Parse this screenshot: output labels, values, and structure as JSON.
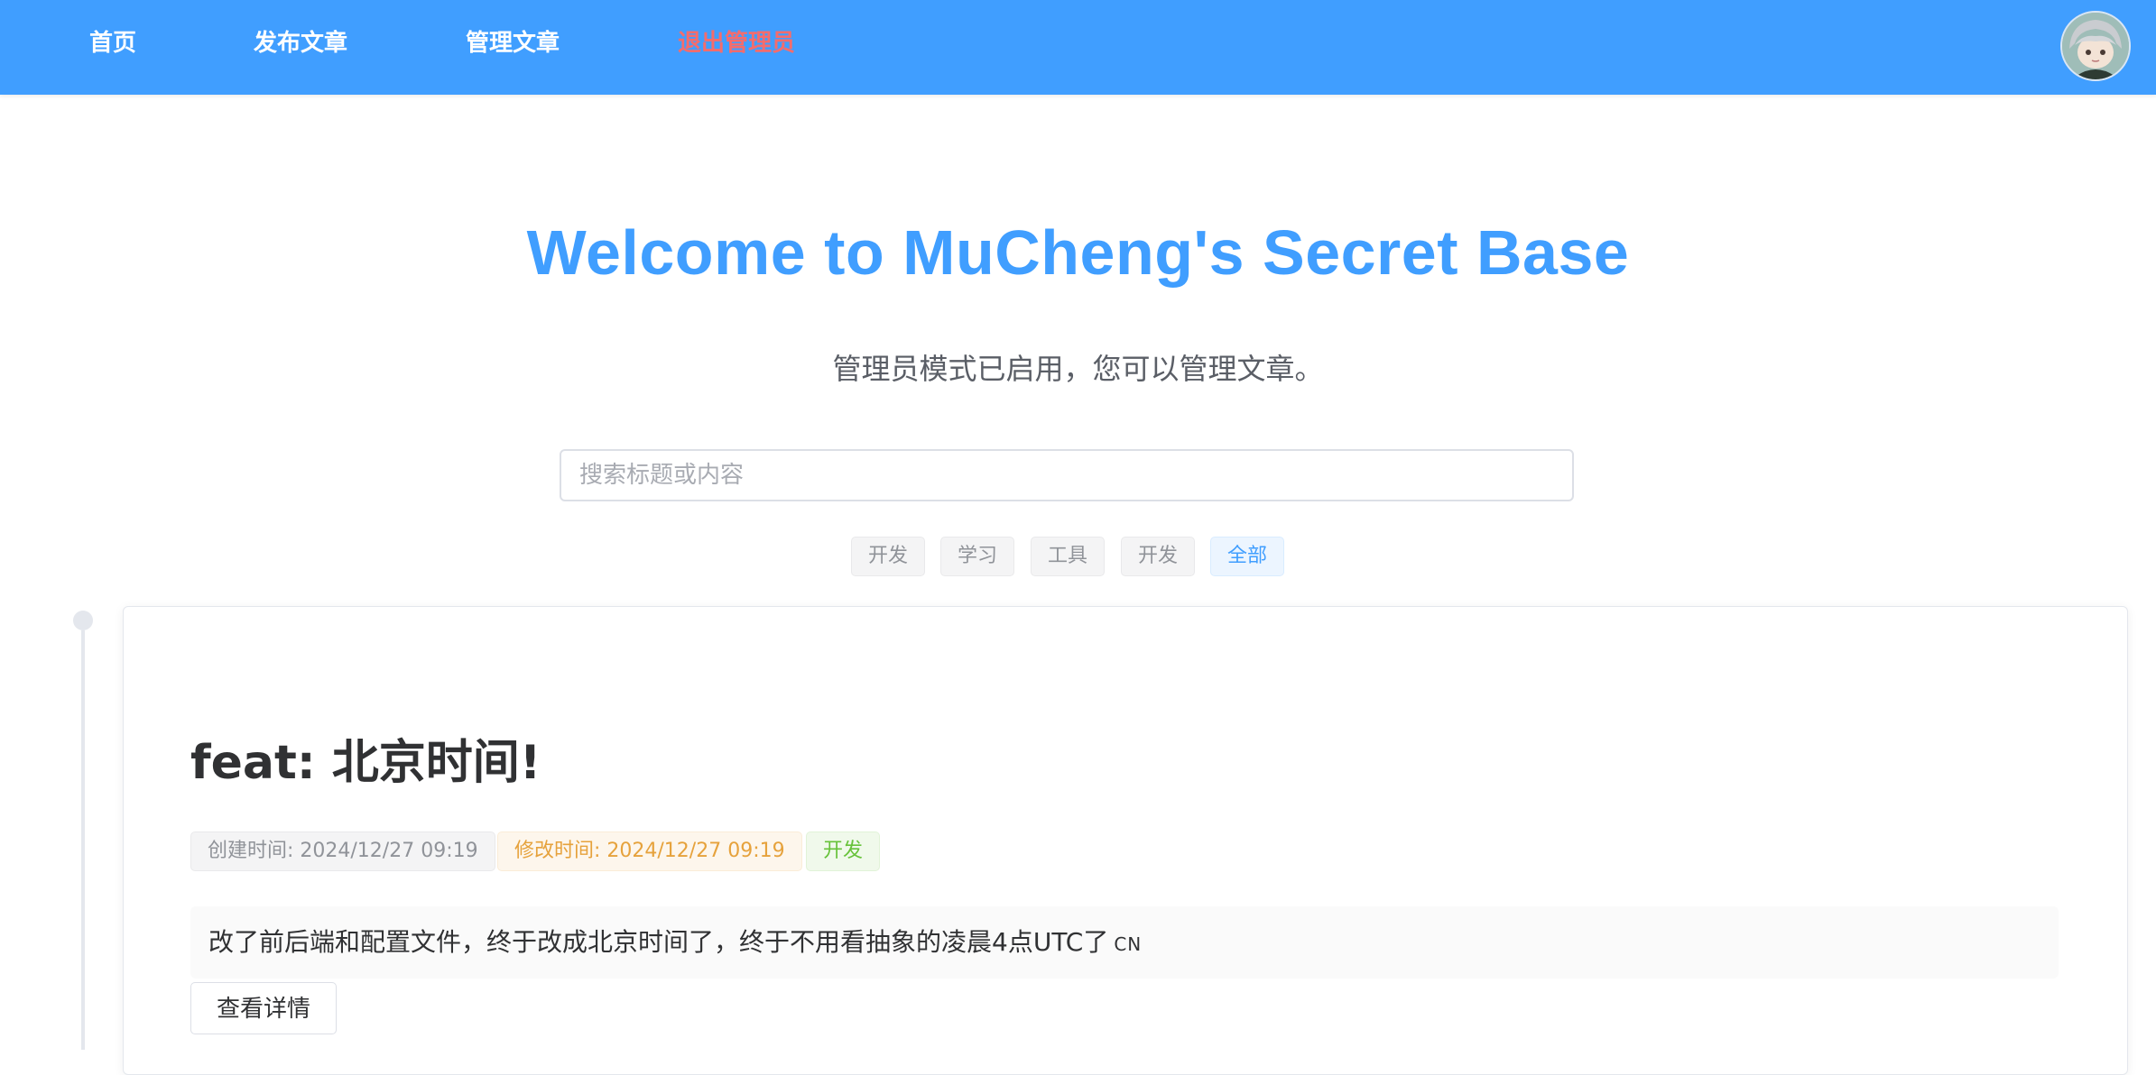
{
  "nav": {
    "home": "首页",
    "publish": "发布文章",
    "manage": "管理文章",
    "logout_admin": "退出管理员"
  },
  "avatar_icon": "user-avatar-icon",
  "hero": {
    "title": "Welcome to MuCheng's Secret Base",
    "subtitle": "管理员模式已启用，您可以管理文章。"
  },
  "search": {
    "placeholder": "搜索标题或内容",
    "value": ""
  },
  "filters": {
    "tags": [
      "开发",
      "学习",
      "工具",
      "开发"
    ],
    "all": "全部",
    "selected": "全部"
  },
  "post": {
    "title": "feat: 北京时间!",
    "created": "创建时间: 2024/12/27 09:19",
    "modified": "修改时间: 2024/12/27 09:19",
    "category": "开发",
    "excerpt": "改了前后端和配置文件，终于改成北京时间了，终于不用看抽象的凌晨4点UTC了",
    "excerpt_flag": "CN",
    "detail_button": "查看详情"
  },
  "colors": {
    "primary": "#409eff",
    "danger": "#f56c6c",
    "warning": "#e6a23c",
    "success": "#67c23a",
    "info": "#909399"
  }
}
